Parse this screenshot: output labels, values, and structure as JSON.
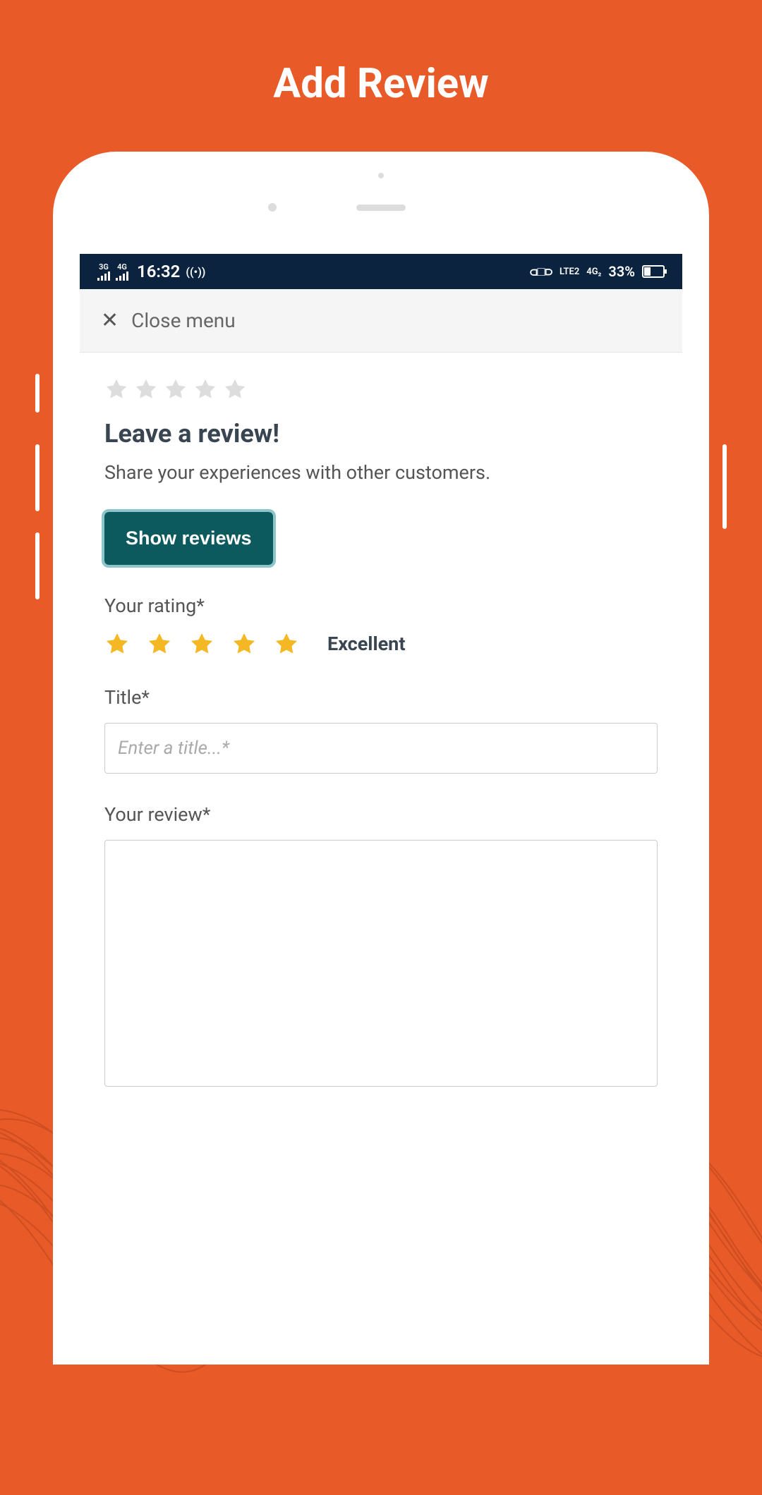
{
  "page": {
    "title": "Add Review"
  },
  "statusBar": {
    "signal1": "3G",
    "signal2": "4G",
    "time": "16:32",
    "lte": "LTE2",
    "network": "4G₂",
    "battery": "33%"
  },
  "closeMenu": {
    "label": "Close menu"
  },
  "review": {
    "heading": "Leave a review!",
    "subheading": "Share your experiences with other customers.",
    "showReviewsLabel": "Show reviews",
    "ratingLabel": "Your rating*",
    "ratingText": "Excellent",
    "titleLabel": "Title*",
    "titlePlaceholder": "Enter a title...*",
    "reviewLabel": "Your review*"
  }
}
